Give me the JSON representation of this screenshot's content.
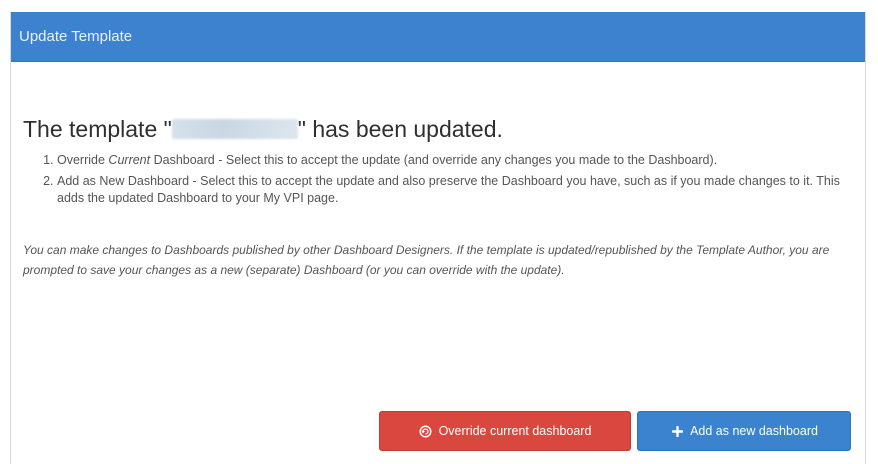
{
  "dialog": {
    "title": "Update Template",
    "headline_prefix": "The template \"",
    "headline_suffix": "\" has been updated.",
    "steps": [
      {
        "number": "1.",
        "name": "Override",
        "name_em": "Current",
        "name_rest": "Dashboard",
        "text": " - Select this to accept the update (and override any changes you made to the Dashboard)."
      },
      {
        "number": "2.",
        "name": "Add as New Dashboard",
        "text": " - Select this to accept the update and also preserve the Dashboard you have, such as if you made changes to it. This adds the updated Dashboard to your My VPI page."
      }
    ],
    "note": "You can make changes to Dashboards published by other Dashboard Designers. If the template is updated/republished by the Template Author, you are prompted to save your changes as a new (separate) Dashboard (or you can override with the update)."
  },
  "buttons": {
    "override_label": "Override current dashboard",
    "override_icon": "override-icon",
    "add_label": "Add as new dashboard",
    "add_icon": "plus-icon"
  },
  "colors": {
    "header": "#3d82cf",
    "danger": "#d9473f",
    "primary": "#3b82cf"
  }
}
